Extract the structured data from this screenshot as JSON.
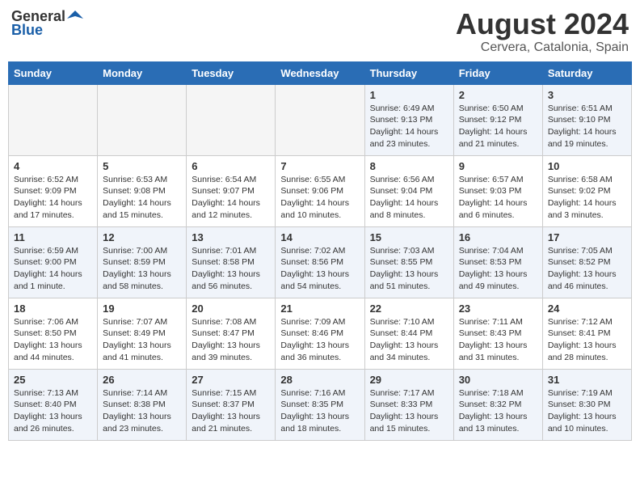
{
  "logo": {
    "general": "General",
    "blue": "Blue"
  },
  "title": "August 2024",
  "subtitle": "Cervera, Catalonia, Spain",
  "weekdays": [
    "Sunday",
    "Monday",
    "Tuesday",
    "Wednesday",
    "Thursday",
    "Friday",
    "Saturday"
  ],
  "weeks": [
    [
      {
        "day": "",
        "info": ""
      },
      {
        "day": "",
        "info": ""
      },
      {
        "day": "",
        "info": ""
      },
      {
        "day": "",
        "info": ""
      },
      {
        "day": "1",
        "info": "Sunrise: 6:49 AM\nSunset: 9:13 PM\nDaylight: 14 hours\nand 23 minutes."
      },
      {
        "day": "2",
        "info": "Sunrise: 6:50 AM\nSunset: 9:12 PM\nDaylight: 14 hours\nand 21 minutes."
      },
      {
        "day": "3",
        "info": "Sunrise: 6:51 AM\nSunset: 9:10 PM\nDaylight: 14 hours\nand 19 minutes."
      }
    ],
    [
      {
        "day": "4",
        "info": "Sunrise: 6:52 AM\nSunset: 9:09 PM\nDaylight: 14 hours\nand 17 minutes."
      },
      {
        "day": "5",
        "info": "Sunrise: 6:53 AM\nSunset: 9:08 PM\nDaylight: 14 hours\nand 15 minutes."
      },
      {
        "day": "6",
        "info": "Sunrise: 6:54 AM\nSunset: 9:07 PM\nDaylight: 14 hours\nand 12 minutes."
      },
      {
        "day": "7",
        "info": "Sunrise: 6:55 AM\nSunset: 9:06 PM\nDaylight: 14 hours\nand 10 minutes."
      },
      {
        "day": "8",
        "info": "Sunrise: 6:56 AM\nSunset: 9:04 PM\nDaylight: 14 hours\nand 8 minutes."
      },
      {
        "day": "9",
        "info": "Sunrise: 6:57 AM\nSunset: 9:03 PM\nDaylight: 14 hours\nand 6 minutes."
      },
      {
        "day": "10",
        "info": "Sunrise: 6:58 AM\nSunset: 9:02 PM\nDaylight: 14 hours\nand 3 minutes."
      }
    ],
    [
      {
        "day": "11",
        "info": "Sunrise: 6:59 AM\nSunset: 9:00 PM\nDaylight: 14 hours\nand 1 minute."
      },
      {
        "day": "12",
        "info": "Sunrise: 7:00 AM\nSunset: 8:59 PM\nDaylight: 13 hours\nand 58 minutes."
      },
      {
        "day": "13",
        "info": "Sunrise: 7:01 AM\nSunset: 8:58 PM\nDaylight: 13 hours\nand 56 minutes."
      },
      {
        "day": "14",
        "info": "Sunrise: 7:02 AM\nSunset: 8:56 PM\nDaylight: 13 hours\nand 54 minutes."
      },
      {
        "day": "15",
        "info": "Sunrise: 7:03 AM\nSunset: 8:55 PM\nDaylight: 13 hours\nand 51 minutes."
      },
      {
        "day": "16",
        "info": "Sunrise: 7:04 AM\nSunset: 8:53 PM\nDaylight: 13 hours\nand 49 minutes."
      },
      {
        "day": "17",
        "info": "Sunrise: 7:05 AM\nSunset: 8:52 PM\nDaylight: 13 hours\nand 46 minutes."
      }
    ],
    [
      {
        "day": "18",
        "info": "Sunrise: 7:06 AM\nSunset: 8:50 PM\nDaylight: 13 hours\nand 44 minutes."
      },
      {
        "day": "19",
        "info": "Sunrise: 7:07 AM\nSunset: 8:49 PM\nDaylight: 13 hours\nand 41 minutes."
      },
      {
        "day": "20",
        "info": "Sunrise: 7:08 AM\nSunset: 8:47 PM\nDaylight: 13 hours\nand 39 minutes."
      },
      {
        "day": "21",
        "info": "Sunrise: 7:09 AM\nSunset: 8:46 PM\nDaylight: 13 hours\nand 36 minutes."
      },
      {
        "day": "22",
        "info": "Sunrise: 7:10 AM\nSunset: 8:44 PM\nDaylight: 13 hours\nand 34 minutes."
      },
      {
        "day": "23",
        "info": "Sunrise: 7:11 AM\nSunset: 8:43 PM\nDaylight: 13 hours\nand 31 minutes."
      },
      {
        "day": "24",
        "info": "Sunrise: 7:12 AM\nSunset: 8:41 PM\nDaylight: 13 hours\nand 28 minutes."
      }
    ],
    [
      {
        "day": "25",
        "info": "Sunrise: 7:13 AM\nSunset: 8:40 PM\nDaylight: 13 hours\nand 26 minutes."
      },
      {
        "day": "26",
        "info": "Sunrise: 7:14 AM\nSunset: 8:38 PM\nDaylight: 13 hours\nand 23 minutes."
      },
      {
        "day": "27",
        "info": "Sunrise: 7:15 AM\nSunset: 8:37 PM\nDaylight: 13 hours\nand 21 minutes."
      },
      {
        "day": "28",
        "info": "Sunrise: 7:16 AM\nSunset: 8:35 PM\nDaylight: 13 hours\nand 18 minutes."
      },
      {
        "day": "29",
        "info": "Sunrise: 7:17 AM\nSunset: 8:33 PM\nDaylight: 13 hours\nand 15 minutes."
      },
      {
        "day": "30",
        "info": "Sunrise: 7:18 AM\nSunset: 8:32 PM\nDaylight: 13 hours\nand 13 minutes."
      },
      {
        "day": "31",
        "info": "Sunrise: 7:19 AM\nSunset: 8:30 PM\nDaylight: 13 hours\nand 10 minutes."
      }
    ]
  ]
}
